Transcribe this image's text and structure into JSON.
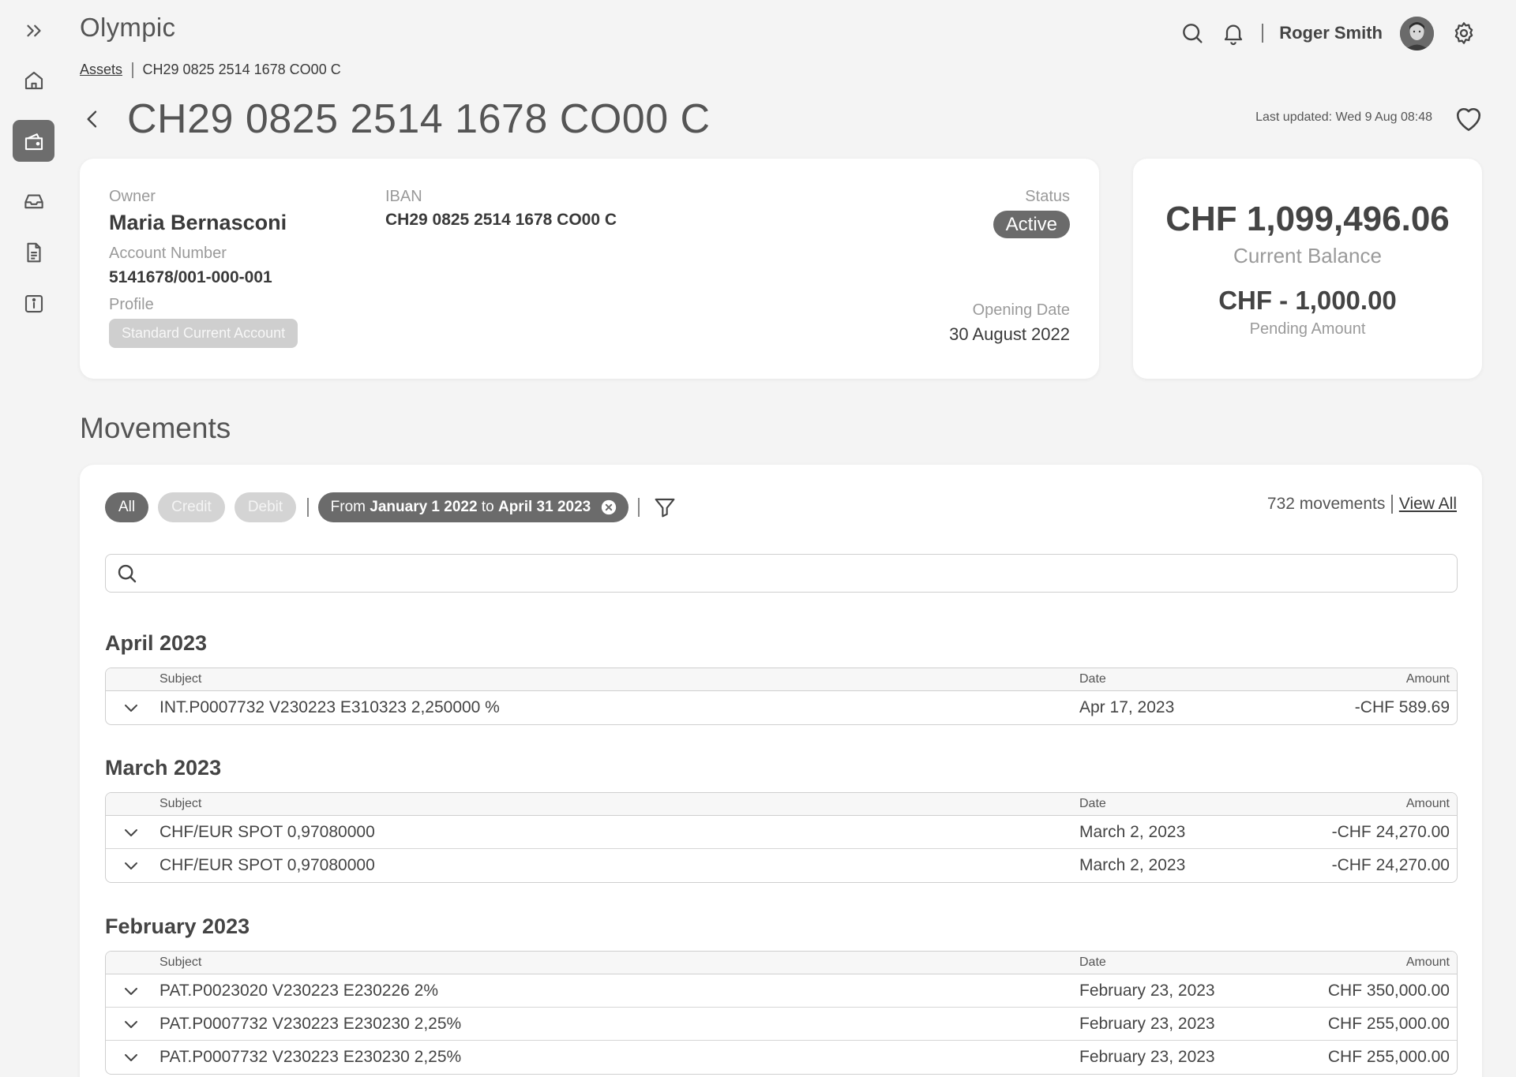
{
  "app": {
    "title": "Olympic"
  },
  "sidebar": {
    "items": [
      {
        "icon": "double-chevron-right-icon"
      },
      {
        "icon": "home-icon"
      },
      {
        "icon": "wallet-icon",
        "active": true
      },
      {
        "icon": "inbox-icon"
      },
      {
        "icon": "document-icon"
      },
      {
        "icon": "info-icon"
      }
    ]
  },
  "header": {
    "user_name": "Roger Smith",
    "icons": [
      "search-icon",
      "bell-icon",
      "avatar",
      "gear-icon"
    ]
  },
  "breadcrumb": {
    "root": "Assets",
    "current": "CH29 0825 2514 1678 CO00 C"
  },
  "page": {
    "title": "CH29 0825 2514 1678 CO00 C",
    "last_updated": "Last updated: Wed 9 Aug 08:48"
  },
  "account": {
    "owner_label": "Owner",
    "owner": "Maria Bernasconi",
    "account_number_label": "Account Number",
    "account_number": "5141678/001-000-001",
    "profile_label": "Profile",
    "profile": "Standard Current Account",
    "iban_label": "IBAN",
    "iban": "CH29 0825 2514 1678 CO00 C",
    "status_label": "Status",
    "status": "Active",
    "opening_date_label": "Opening Date",
    "opening_date": "30 August 2022"
  },
  "balance": {
    "current": "CHF 1,099,496.06",
    "current_label": "Current Balance",
    "pending": "CHF - 1,000.00",
    "pending_label": "Pending Amount"
  },
  "movements": {
    "title": "Movements",
    "filters": {
      "all": "All",
      "credit": "Credit",
      "debit": "Debit"
    },
    "range": {
      "from_word": "From",
      "from": "January 1 2022",
      "to_word": "to",
      "to": "April 31 2023"
    },
    "count": "732 movements",
    "view_all": "View All",
    "search_placeholder": "",
    "columns": {
      "subject": "Subject",
      "date": "Date",
      "amount": "Amount"
    },
    "groups": [
      {
        "title": "April 2023",
        "rows": [
          {
            "subject": "INT.P0007732 V230223 E310323 2,250000 %",
            "date": "Apr 17, 2023",
            "amount": "-CHF 589.69"
          }
        ]
      },
      {
        "title": "March 2023",
        "rows": [
          {
            "subject": "CHF/EUR SPOT 0,97080000",
            "date": "March 2, 2023",
            "amount": "-CHF 24,270.00"
          },
          {
            "subject": "CHF/EUR SPOT 0,97080000",
            "date": "March 2, 2023",
            "amount": "-CHF 24,270.00"
          }
        ]
      },
      {
        "title": "February 2023",
        "rows": [
          {
            "subject": "PAT.P0023020 V230223 E230226 2%",
            "date": "February 23, 2023",
            "amount": "CHF 350,000.00"
          },
          {
            "subject": "PAT.P0007732 V230223 E230230 2,25%",
            "date": "February 23, 2023",
            "amount": "CHF 255,000.00"
          },
          {
            "subject": "PAT.P0007732 V230223 E230230 2,25%",
            "date": "February 23, 2023",
            "amount": "CHF 255,000.00"
          }
        ]
      }
    ]
  }
}
